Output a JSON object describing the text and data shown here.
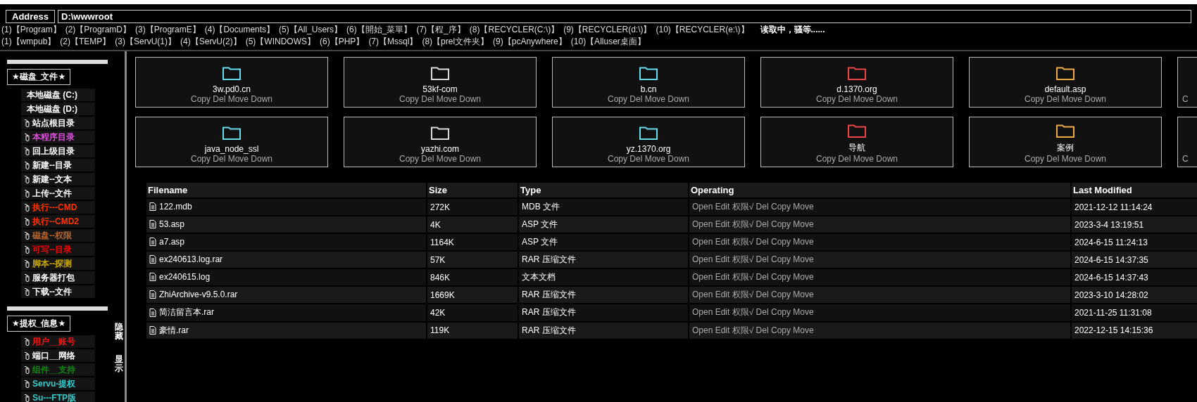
{
  "address": {
    "label": "Address",
    "value": "D:\\wwwroot"
  },
  "quick_links": [
    [
      "(1)【Program】",
      "(2)【ProgramD】",
      "(3)【ProgramE】",
      "(4)【Documents】",
      "(5)【All_Users】",
      "(6)【開始_菜單】",
      "(7)【程_序】",
      "(8)【RECYCLER(C:\\)】",
      "(9)【RECYCLER(d:\\)】",
      "(10)【RECYCLER(e:\\)】"
    ],
    [
      "(1)【wmpub】",
      "(2)【TEMP】",
      "(3)【ServU(1)】",
      "(4)【ServU(2)】",
      "(5)【WINDOWS】",
      "(6)【PHP】",
      "(7)【Mssql】",
      "(8)【prel文件夹】",
      "(9)【pcAnywhere】",
      "(10)【Alluser桌面】"
    ]
  ],
  "loading_text": "读取中，骚等......",
  "sidebar": {
    "sections": [
      {
        "title": "★磁盘_文件★",
        "items": [
          {
            "kind": "drive",
            "label": "本地磁盘 (C:)",
            "color": "#ffffff"
          },
          {
            "kind": "drive",
            "label": "本地磁盘 (D:)",
            "color": "#ffffff"
          },
          {
            "kind": "link",
            "label": "站点根目录",
            "color": "#ffffff"
          },
          {
            "kind": "link",
            "label": "本程序目录",
            "color": "#e050e0"
          },
          {
            "kind": "link",
            "label": "回上级目录",
            "color": "#ffffff"
          },
          {
            "kind": "link",
            "label": "新建--目录",
            "color": "#ffffff"
          },
          {
            "kind": "link",
            "label": "新建--文本",
            "color": "#ffffff"
          },
          {
            "kind": "link",
            "label": "上传--文件",
            "color": "#ffffff"
          },
          {
            "kind": "link",
            "label": "执行---CMD",
            "color": "#ff3300"
          },
          {
            "kind": "link",
            "label": "执行--CMD2",
            "color": "#ff3300"
          },
          {
            "kind": "link",
            "label": "磁盘--权限",
            "color": "#b8632a"
          },
          {
            "kind": "link",
            "label": "可写--目录",
            "color": "#ff0000"
          },
          {
            "kind": "link",
            "label": "脚本--探测",
            "color": "#ccaa00"
          },
          {
            "kind": "link",
            "label": "服务器打包",
            "color": "#ffffff"
          },
          {
            "kind": "link",
            "label": "下载--文件",
            "color": "#ffffff"
          }
        ]
      },
      {
        "title": "★提权_信息★",
        "items": [
          {
            "kind": "link",
            "label": "用户__账号",
            "color": "#ff1111"
          },
          {
            "kind": "link",
            "label": "端口__网络",
            "color": "#ffffff"
          },
          {
            "kind": "link",
            "label": "组件__支持",
            "color": "#118811"
          },
          {
            "kind": "link",
            "label": "Servu-提权",
            "color": "#33cccc"
          },
          {
            "kind": "link",
            "label": "Su---FTP版",
            "color": "#33cccc"
          }
        ]
      }
    ],
    "hide_label": "隐藏",
    "show_label": "显示"
  },
  "folders": [
    [
      {
        "name": "3w.pd0.cn",
        "actions": "Copy Del Move Down",
        "color": "#66ddee"
      },
      {
        "name": "53kf-com",
        "actions": "Copy Del Move Down",
        "color": "#dddddd"
      },
      {
        "name": "b.cn",
        "actions": "Copy Del Move Down",
        "color": "#66ddee"
      },
      {
        "name": "d.1370.org",
        "actions": "Copy Del Move Down",
        "color": "#ee4444"
      },
      {
        "name": "default.asp",
        "actions": "Copy Del Move Down",
        "color": "#eeaa44"
      },
      {
        "actions": "C"
      }
    ],
    [
      {
        "name": "java_node_ssl",
        "actions": "Copy Del Move Down",
        "color": "#66ddee"
      },
      {
        "name": "yazhi.com",
        "actions": "Copy Del Move Down",
        "color": "#dddddd"
      },
      {
        "name": "yz.1370.org",
        "actions": "Copy Del Move Down",
        "color": "#66ddee"
      },
      {
        "name": "导航",
        "actions": "Copy Del Move Down",
        "color": "#ee4444"
      },
      {
        "name": "案例",
        "actions": "Copy Del Move Down",
        "color": "#eeaa44"
      },
      {
        "actions": "C"
      }
    ]
  ],
  "table": {
    "columns": [
      "Filename",
      "Size",
      "Type",
      "Operating",
      "Last Modified"
    ],
    "rows": [
      [
        "122.mdb",
        "272K",
        "MDB 文件",
        "Open Edit 权限√ Del Copy Move",
        "2021-12-12 11:14:24"
      ],
      [
        "53.asp",
        "4K",
        "ASP 文件",
        "Open Edit 权限√ Del Copy Move",
        "2023-3-4 13:19:51"
      ],
      [
        "a7.asp",
        "1164K",
        "ASP 文件",
        "Open Edit 权限√ Del Copy Move",
        "2024-6-15 11:24:13"
      ],
      [
        "ex240613.log.rar",
        "57K",
        "RAR 压缩文件",
        "Open Edit 权限√ Del Copy Move",
        "2024-6-15 14:37:35"
      ],
      [
        "ex240615.log",
        "846K",
        "文本文档",
        "Open Edit 权限√ Del Copy Move",
        "2024-6-15 14:37:43"
      ],
      [
        "ZhiArchive-v9.5.0.rar",
        "1669K",
        "RAR 压缩文件",
        "Open Edit 权限√ Del Copy Move",
        "2023-3-10 14:28:02"
      ],
      [
        "简洁留言本.rar",
        "42K",
        "RAR 压缩文件",
        "Open Edit 权限√ Del Copy Move",
        "2021-11-25 11:31:08"
      ],
      [
        "豪情.rar",
        "119K",
        "RAR 压缩文件",
        "Open Edit 权限√ Del Copy Move",
        "2022-12-15 14:15:36"
      ]
    ]
  }
}
